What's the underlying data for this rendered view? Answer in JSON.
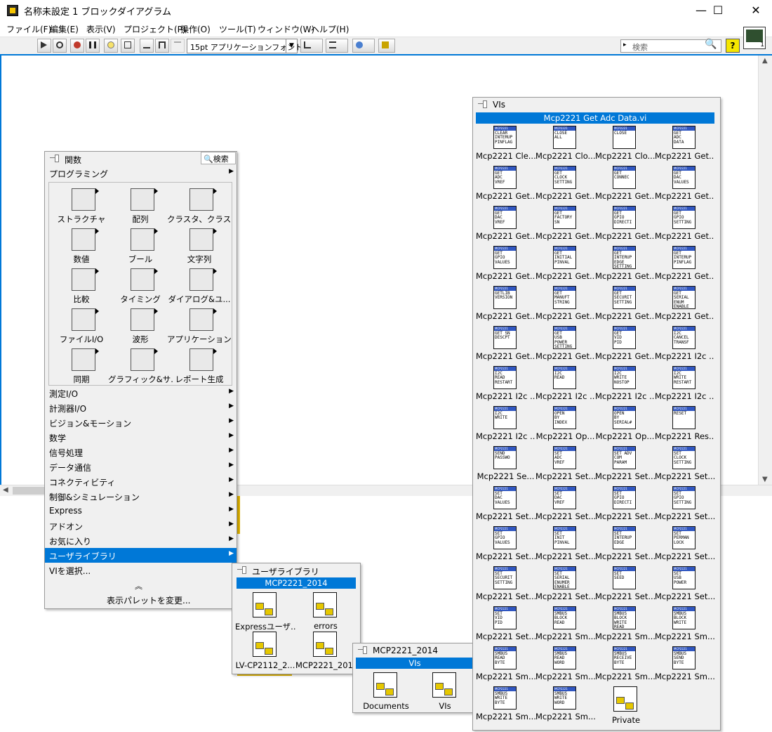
{
  "window": {
    "title": "名称未設定 1 ブロックダイアグラム",
    "minimize": "—",
    "maximize": "☐",
    "close": "✕"
  },
  "menu": [
    "ファイル(F)",
    "編集(E)",
    "表示(V)",
    "プロジェクト(P)",
    "操作(O)",
    "ツール(T)",
    "ウィンドウ(W)",
    "ヘルプ(H)"
  ],
  "toolbar": {
    "font": "15pt アプリケーションフォント",
    "search_placeholder": "検索",
    "help": "?",
    "vi_icon_number": "1"
  },
  "functions_palette": {
    "title": "関数",
    "search_label": "検索",
    "section": "プログラミング",
    "categories": [
      "ストラクチャ",
      "配列",
      "クラスタ、クラス...",
      "数値",
      "ブール",
      "文字列",
      "比較",
      "タイミング",
      "ダイアログ&ユ...",
      "ファイルI/O",
      "波形",
      "アプリケーション...",
      "同期",
      "グラフィック&サ...",
      "レポート生成"
    ],
    "items": [
      "測定I/O",
      "計測器I/O",
      "ビジョン&モーション",
      "数学",
      "信号処理",
      "データ通信",
      "コネクティビティ",
      "制御&シミュレーション",
      "Express",
      "アドオン",
      "お気に入り",
      "ユーザライブラリ",
      "VIを選択..."
    ],
    "selected_item": "ユーザライブラリ",
    "collapse": "︽",
    "change_palette": "表示パレットを変更..."
  },
  "user_lib_palette": {
    "title": "ユーザライブラリ",
    "folder": "MCP2221_2014",
    "items": [
      "Expressユーザ...",
      "errors",
      "LV-CP2112_2...",
      "MCP2221_2014"
    ]
  },
  "mcp_palette": {
    "title": "MCP2221_2014",
    "folder": "VIs",
    "items": [
      "Documents",
      "VIs"
    ]
  },
  "vis_palette": {
    "title": "VIs",
    "highlight": "Mcp2221 Get Adc Data.vi",
    "vis": [
      {
        "icon": "CLEAR\nINTERUP\nPINFLAG",
        "label": "Mcp2221 Cle..."
      },
      {
        "icon": "CLOSE\nALL",
        "label": "Mcp2221 Clo..."
      },
      {
        "icon": "CLOSE",
        "label": "Mcp2221 Clo..."
      },
      {
        "icon": "GET\nADC\nDATA",
        "label": "Mcp2221 Get..."
      },
      {
        "icon": "GET\nADC\nVREF",
        "label": "Mcp2221 Get..."
      },
      {
        "icon": "GET\nCLOCK\nSETTING",
        "label": "Mcp2221 Get..."
      },
      {
        "icon": "GET\nCONNEC",
        "label": "Mcp2221 Get..."
      },
      {
        "icon": "GET\nDAC\nVALUES",
        "label": "Mcp2221 Get..."
      },
      {
        "icon": "GET\nDAC\nVREF",
        "label": "Mcp2221 Get..."
      },
      {
        "icon": "GET\nFACTORY\nSN",
        "label": "Mcp2221 Get..."
      },
      {
        "icon": "GET\nGPIO\nDIRECTI",
        "label": "Mcp2221 Get..."
      },
      {
        "icon": "GET\nGPIO\nSETTING",
        "label": "Mcp2221 Get..."
      },
      {
        "icon": "GET\nGPIO\nVALUES",
        "label": "Mcp2221 Get..."
      },
      {
        "icon": "GET\nINITIAL\nPINVAL",
        "label": "Mcp2221 Get..."
      },
      {
        "icon": "GET\nINTERUP\nEDGE\nSETTING",
        "label": "Mcp2221 Get..."
      },
      {
        "icon": "GET\nINTERUP\nPINFLAG",
        "label": "Mcp2221 Get..."
      },
      {
        "icon": "GETLIB\nVERSION",
        "label": "Mcp2221 Get..."
      },
      {
        "icon": "GET\nMANUFT\nSTRING",
        "label": "Mcp2221 Get..."
      },
      {
        "icon": "GET\nSECURIT\nSETTING",
        "label": "Mcp2221 Get..."
      },
      {
        "icon": "GET\nSERIAL\nENUM\nENABLE",
        "label": "Mcp2221 Get..."
      },
      {
        "icon": "GET SN\nDESCPT",
        "label": "Mcp2221 Get..."
      },
      {
        "icon": "GET\nUSB\nPOWER\nSETTING",
        "label": "Mcp2221 Get..."
      },
      {
        "icon": "GET\nVID\nPID",
        "label": "Mcp2221 Get..."
      },
      {
        "icon": "I2C\nCANCEL\nTRANSF",
        "label": "Mcp2221 I2c ..."
      },
      {
        "icon": "I2C\nREAD\nRESTART",
        "label": "Mcp2221 I2c ..."
      },
      {
        "icon": "I2C\nREAD",
        "label": "Mcp2221 I2c ..."
      },
      {
        "icon": "I2C\nWRITE\nNOSTOP",
        "label": "Mcp2221 I2c ..."
      },
      {
        "icon": "I2C\nWRITE\nRESTART",
        "label": "Mcp2221 I2c ..."
      },
      {
        "icon": "I2C\nWRITE",
        "label": "Mcp2221 I2c ..."
      },
      {
        "icon": "OPEN\nBY\nINDEX",
        "label": "Mcp2221 Op..."
      },
      {
        "icon": "OPEN\nBY\nSERIAL#",
        "label": "Mcp2221 Op..."
      },
      {
        "icon": "RESET",
        "label": "Mcp2221 Res..."
      },
      {
        "icon": "SEND\nPASSWO",
        "label": "Mcp2221 Se..."
      },
      {
        "icon": "SET\nADC\nVREF",
        "label": "Mcp2221 Set..."
      },
      {
        "icon": "SET ADV\nCOM\nPARAM",
        "label": "Mcp2221 Set..."
      },
      {
        "icon": "SET\nCLOCK\nSETTING",
        "label": "Mcp2221 Set..."
      },
      {
        "icon": "SET\nDAC\nVALUES",
        "label": "Mcp2221 Set..."
      },
      {
        "icon": "SET\nDAC\nVREF",
        "label": "Mcp2221 Set..."
      },
      {
        "icon": "SET\nGPIO\nDIRECTI",
        "label": "Mcp2221 Set..."
      },
      {
        "icon": "SET\nGPIO\nSETTING",
        "label": "Mcp2221 Set..."
      },
      {
        "icon": "SET\nGPIO\nVALUES",
        "label": "Mcp2221 Set..."
      },
      {
        "icon": "SET\nINIT\nPINVAL",
        "label": "Mcp2221 Set..."
      },
      {
        "icon": "SET\nINTERUP\nEDGE",
        "label": "Mcp2221 Set..."
      },
      {
        "icon": "SET\nPERMAN\nLOCK",
        "label": "Mcp2221 Set..."
      },
      {
        "icon": "SET\nSECURIT\nSETTING",
        "label": "Mcp2221 Set..."
      },
      {
        "icon": "SET\nSERIAL\nENUMER\nENABLE",
        "label": "Mcp2221 Set..."
      },
      {
        "icon": "SET\nSEED",
        "label": "Mcp2221 Set..."
      },
      {
        "icon": "SET\nUSB\nPOWER",
        "label": "Mcp2221 Set..."
      },
      {
        "icon": "SET\nVID\nPID",
        "label": "Mcp2221 Set..."
      },
      {
        "icon": "SMBUS\nBLOCK\nREAD",
        "label": "Mcp2221 Sm..."
      },
      {
        "icon": "SMBUS\nBLOCK\nWRITE\nREAD",
        "label": "Mcp2221 Sm..."
      },
      {
        "icon": "SMBUS\nBLOCK\nWRITE",
        "label": "Mcp2221 Sm..."
      },
      {
        "icon": "SMBUS\nREAD\nBYTE",
        "label": "Mcp2221 Sm..."
      },
      {
        "icon": "SMBUS\nREAD\nWORD",
        "label": "Mcp2221 Sm..."
      },
      {
        "icon": "SMBUS\nRECEIVE\nBYTE",
        "label": "Mcp2221 Sm..."
      },
      {
        "icon": "SMBUS\nSEND\nBYTE",
        "label": "Mcp2221 Sm..."
      },
      {
        "icon": "SMBUS\nWRITE\nBYTE",
        "label": "Mcp2221 Sm..."
      },
      {
        "icon": "SMBUS\nWRITE\nWORD",
        "label": "Mcp2221 Sm..."
      }
    ],
    "private_folder": "Private"
  }
}
